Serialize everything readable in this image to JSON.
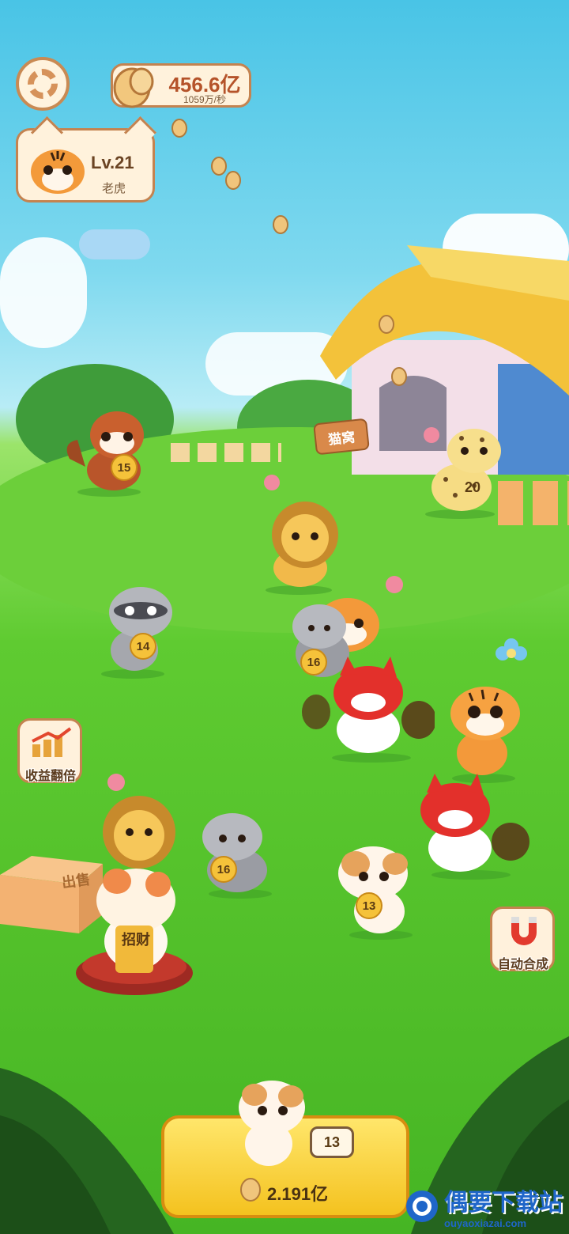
{
  "currency": {
    "amount": "456.6亿",
    "rate": "1059万/秒",
    "icon": "fish-coin-icon"
  },
  "player": {
    "level": "Lv.21",
    "animal_name": "老虎",
    "avatar": "tiger-avatar-icon"
  },
  "signs": {
    "house": "猫窝",
    "sell_box": "出售",
    "lucky_cat": "招财"
  },
  "buttons": {
    "double_income": "收益翻倍",
    "auto_merge": "自动合成",
    "settings_icon": "gear-icon"
  },
  "animals": [
    {
      "kind": "red-panda",
      "level": "15"
    },
    {
      "kind": "leopard",
      "level": "20"
    },
    {
      "kind": "lion",
      "level": ""
    },
    {
      "kind": "raccoon",
      "level": "14"
    },
    {
      "kind": "manul-cat",
      "level": "16"
    },
    {
      "kind": "tiger",
      "level": ""
    },
    {
      "kind": "red-fox-cat",
      "level": ""
    },
    {
      "kind": "tiger-2",
      "level": ""
    },
    {
      "kind": "red-fox-cat-2",
      "level": ""
    },
    {
      "kind": "lion-2",
      "level": ""
    },
    {
      "kind": "manul-cat-2",
      "level": "16"
    },
    {
      "kind": "calico-cat",
      "level": "13"
    }
  ],
  "shop": {
    "cat_level": "13",
    "price": "2.191亿"
  },
  "watermark": {
    "title": "偶要下载站",
    "url": "ouyaoxiazai.com"
  }
}
